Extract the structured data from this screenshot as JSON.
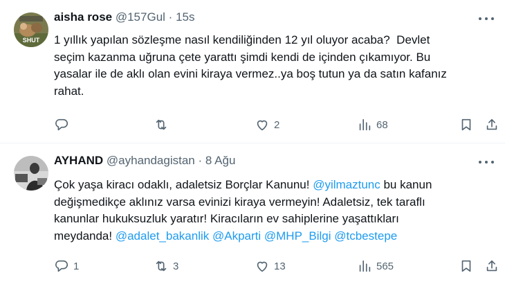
{
  "tweets": [
    {
      "author_name": "aisha rose",
      "handle": "@157Gul",
      "separator": "·",
      "time": "15s",
      "text_parts": {
        "main": "1 yıllık yapılan sözleşme nasıl kendiliğinden 12 yıl oluyor acaba?  Devlet\nseçim kazanma uğruna çete yarattı şimdi kendi de içinden çıkamıyor. Bu\nyasalar ile de aklı olan evini kiraya vermez..ya boş tutun ya da satın kafanız\nrahat."
      },
      "avatar_text": "SHUT",
      "replies": "",
      "retweets": "",
      "likes": "2",
      "views": "68"
    },
    {
      "author_name": "AYHAND",
      "handle": "@ayhandagistan",
      "separator": "·",
      "time": "8 Ağu",
      "text_parts": {
        "p1": "Çok yaşa kiracı odaklı, adaletsiz Borçlar Kanunu! ",
        "m1": "@yilmaztunc",
        "p2": " bu kanun\ndeğişmedikçe aklınız varsa evinizi kiraya vermeyin! Adaletsiz, tek taraflı\nkanunlar hukuksuzluk yaratır! Kiracıların ev sahiplerine yaşattıkları\nmeydanda! ",
        "m2": "@adalet_bakanlik",
        "sp1": " ",
        "m3": "@Akparti",
        "sp2": " ",
        "m4": "@MHP_Bilgi",
        "sp3": " ",
        "m5": "@tcbestepe"
      },
      "replies": "1",
      "retweets": "3",
      "likes": "13",
      "views": "565"
    }
  ],
  "icons": {
    "reply": "reply-icon",
    "retweet": "retweet-icon",
    "like": "heart-icon",
    "views": "views-icon",
    "bookmark": "bookmark-icon",
    "share": "share-icon",
    "more": "more-icon"
  },
  "colors": {
    "text": "#0f1419",
    "secondary": "#536471",
    "link": "#1d9bf0",
    "divider": "#eff3f4"
  }
}
